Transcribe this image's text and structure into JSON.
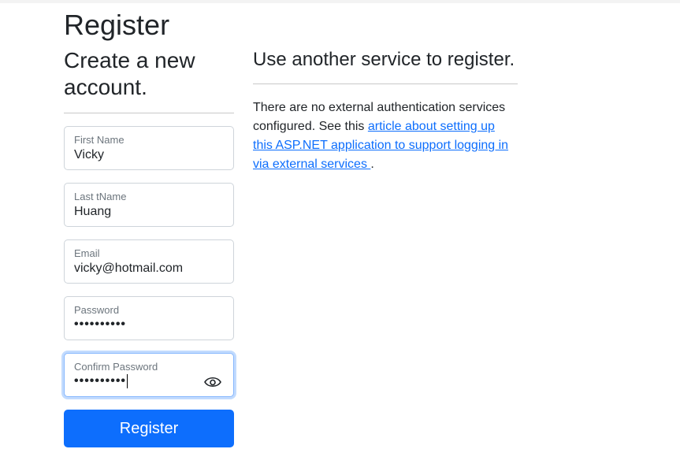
{
  "page": {
    "title": "Register"
  },
  "form": {
    "heading": "Create a new account.",
    "fields": [
      {
        "label": "First Name",
        "value": "Vicky"
      },
      {
        "label": "Last tName",
        "value": "Huang"
      },
      {
        "label": "Email",
        "value": "vicky@hotmail.com"
      },
      {
        "label": "Password",
        "value": "••••••••••"
      },
      {
        "label": "Confirm Password",
        "value": "••••••••••",
        "focused": true
      }
    ],
    "submit_label": "Register"
  },
  "external": {
    "heading": "Use another service to register.",
    "text_before": "There are no external authentication services configured. See this ",
    "link_text": "article about setting up this ASP.NET application to support logging in via external services ",
    "text_after": "."
  },
  "colors": {
    "accent": "#0d6efd",
    "focus_border": "#86b7fe"
  },
  "icons": {
    "show_password": "eye-icon"
  }
}
